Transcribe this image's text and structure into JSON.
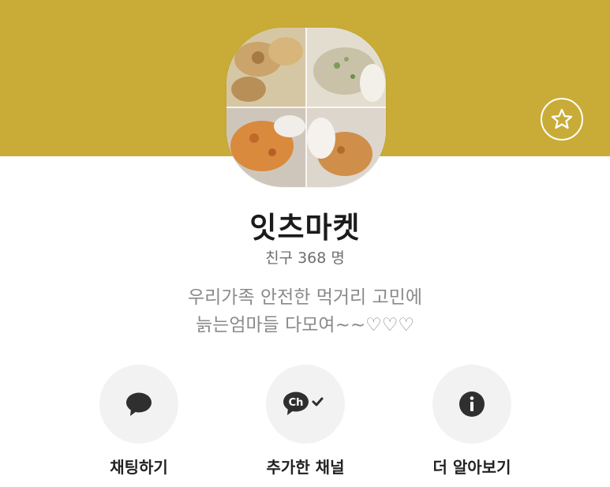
{
  "colors": {
    "banner": "#c9ac37",
    "icon_dark": "#2f2f2f",
    "button_bg": "#f2f2f2"
  },
  "header": {
    "star_icon": "star-outline-icon"
  },
  "profile": {
    "name": "잇츠마켓",
    "friends_label": "친구 368 명",
    "description_lines": [
      "우리가족 안전한 먹거리 고민에",
      "늙는엄마들 다모여~~♡♡♡"
    ]
  },
  "actions": [
    {
      "label": "채팅하기",
      "icon": "chat-bubble-icon"
    },
    {
      "label": "추가한 채널",
      "icon": "channel-added-icon"
    },
    {
      "label": "더 알아보기",
      "icon": "info-icon"
    }
  ]
}
